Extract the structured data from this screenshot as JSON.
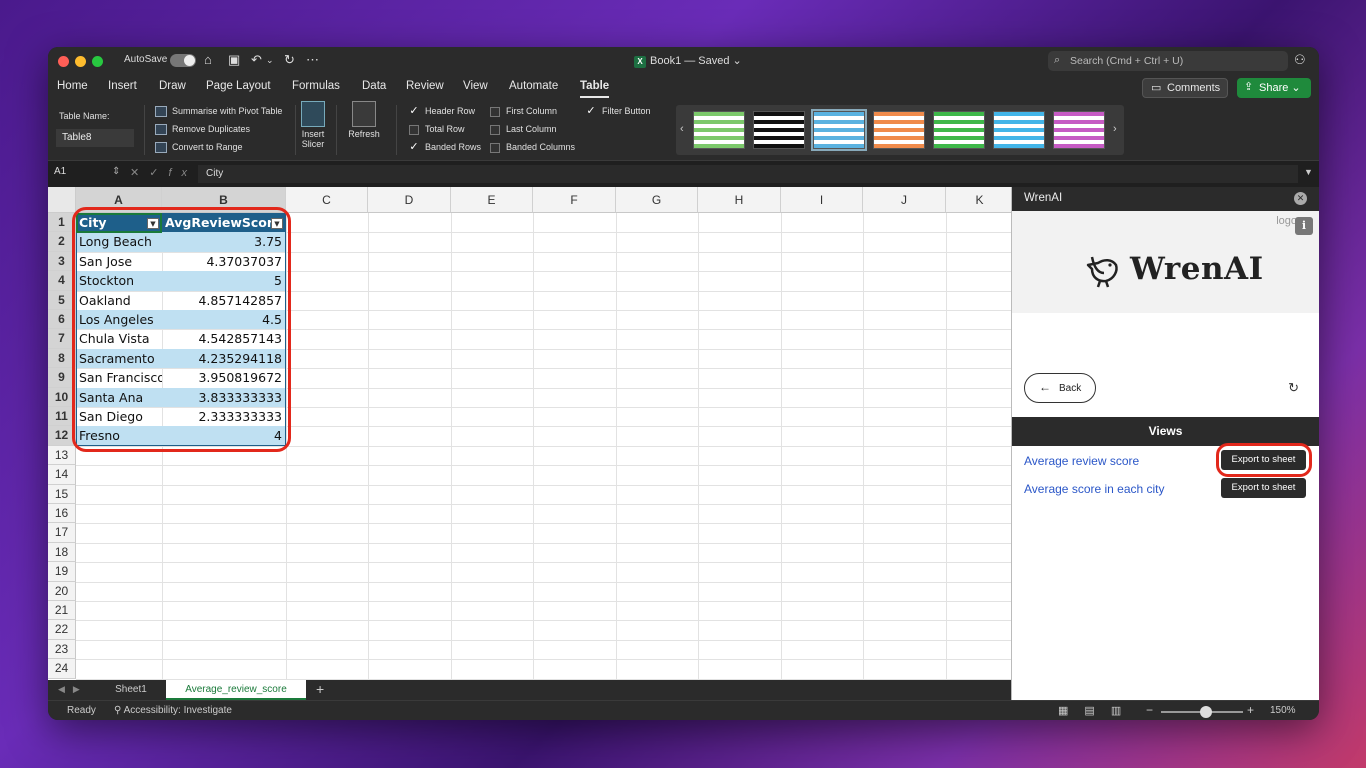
{
  "titlebar": {
    "autosave_label": "AutoSave",
    "doc_title": "Book1 — Saved",
    "search_placeholder": "Search (Cmd + Ctrl + U)"
  },
  "menu": {
    "tabs": [
      "Home",
      "Insert",
      "Draw",
      "Page Layout",
      "Formulas",
      "Data",
      "Review",
      "View",
      "Automate",
      "Table"
    ],
    "active_tab": "Table",
    "comments_label": "Comments",
    "share_label": "Share"
  },
  "ribbon": {
    "table_name_label": "Table Name:",
    "table_name_value": "Table8",
    "summarise": "Summarise with Pivot Table",
    "remove_duplicates": "Remove Duplicates",
    "convert_to_range": "Convert to Range",
    "insert_slicer_1": "Insert",
    "insert_slicer_2": "Slicer",
    "refresh": "Refresh",
    "options": {
      "header_row": "Header Row",
      "total_row": "Total Row",
      "banded_rows": "Banded Rows",
      "first_column": "First Column",
      "last_column": "Last Column",
      "banded_columns": "Banded Columns",
      "filter_button": "Filter Button"
    },
    "style_colors": [
      "#7cc96b",
      "#111111",
      "#5ab2e0",
      "#f08b4b",
      "#3fb84a",
      "#43b5e8",
      "#c65bc4"
    ]
  },
  "formula_bar": {
    "name_box": "A1",
    "fx": "fx",
    "content": "City"
  },
  "grid": {
    "columns": [
      "A",
      "B",
      "C",
      "D",
      "E",
      "F",
      "G",
      "H",
      "I",
      "J",
      "K"
    ],
    "rows": [
      "1",
      "2",
      "3",
      "4",
      "5",
      "6",
      "7",
      "8",
      "9",
      "10",
      "11",
      "12",
      "13",
      "14",
      "15",
      "16",
      "17",
      "18",
      "19",
      "20",
      "21",
      "22",
      "23",
      "24"
    ],
    "table_header": [
      "City",
      "AvgReviewScore"
    ],
    "table_rows": [
      [
        "Long Beach",
        "3.75"
      ],
      [
        "San Jose",
        "4.37037037"
      ],
      [
        "Stockton",
        "5"
      ],
      [
        "Oakland",
        "4.857142857"
      ],
      [
        "Los Angeles",
        "4.5"
      ],
      [
        "Chula Vista",
        "4.542857143"
      ],
      [
        "Sacramento",
        "4.235294118"
      ],
      [
        "San Francisco",
        "3.950819672"
      ],
      [
        "Santa Ana",
        "3.833333333"
      ],
      [
        "San Diego",
        "2.333333333"
      ],
      [
        "Fresno",
        "4"
      ]
    ]
  },
  "pane": {
    "title": "WrenAI",
    "logo_alt": "logo",
    "logo_text": "WrenAI",
    "back_label": "Back",
    "views_header": "Views",
    "views": [
      {
        "label": "Average review score",
        "button": "Export to sheet"
      },
      {
        "label": "Average score in each city",
        "button": "Export to sheet"
      }
    ]
  },
  "sheets": {
    "tabs": [
      "Sheet1",
      "Average_review_score"
    ],
    "active": "Average_review_score"
  },
  "status": {
    "ready": "Ready",
    "accessibility": "Accessibility: Investigate",
    "zoom": "150%"
  }
}
